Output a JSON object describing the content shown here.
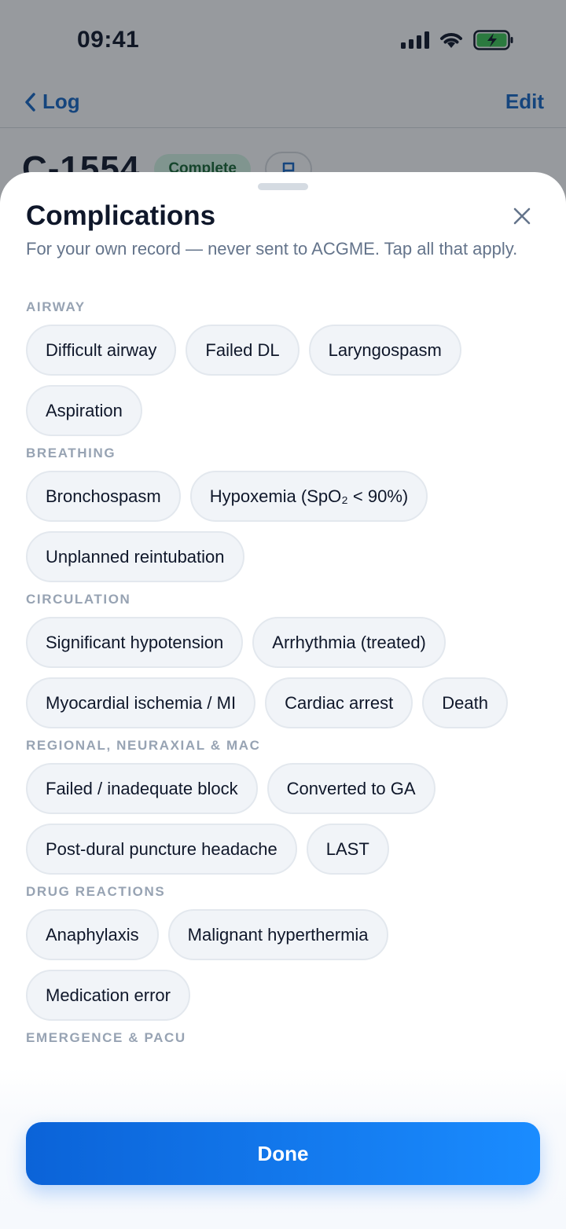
{
  "status_bar": {
    "time": "09:41"
  },
  "nav": {
    "back_label": "Log",
    "edit_label": "Edit"
  },
  "case": {
    "id": "C-1554",
    "status": "Complete"
  },
  "sheet": {
    "title": "Complications",
    "subtitle": "For your own record — never sent to ACGME. Tap all that apply.",
    "sections": [
      {
        "label": "AIRWAY",
        "items": [
          "Difficult airway",
          "Failed DL",
          "Laryngospasm",
          "Aspiration"
        ]
      },
      {
        "label": "BREATHING",
        "items": [
          "Bronchospasm",
          "Hypoxemia (SpO₂ < 90%)",
          "Unplanned reintubation"
        ]
      },
      {
        "label": "CIRCULATION",
        "items": [
          "Significant hypotension",
          "Arrhythmia (treated)",
          "Myocardial ischemia / MI",
          "Cardiac arrest",
          "Death"
        ]
      },
      {
        "label": "REGIONAL, NEURAXIAL & MAC",
        "items": [
          "Failed / inadequate block",
          "Converted to GA",
          "Post-dural puncture headache",
          "LAST"
        ]
      },
      {
        "label": "DRUG REACTIONS",
        "items": [
          "Anaphylaxis",
          "Malignant hyperthermia",
          "Medication error"
        ]
      },
      {
        "label": "EMERGENCE & PACU",
        "items": []
      }
    ],
    "done_label": "Done"
  },
  "colors": {
    "accent": "#1565c0",
    "button": "#1a8cff",
    "badge_bg": "#cdeede",
    "badge_text": "#166534"
  }
}
